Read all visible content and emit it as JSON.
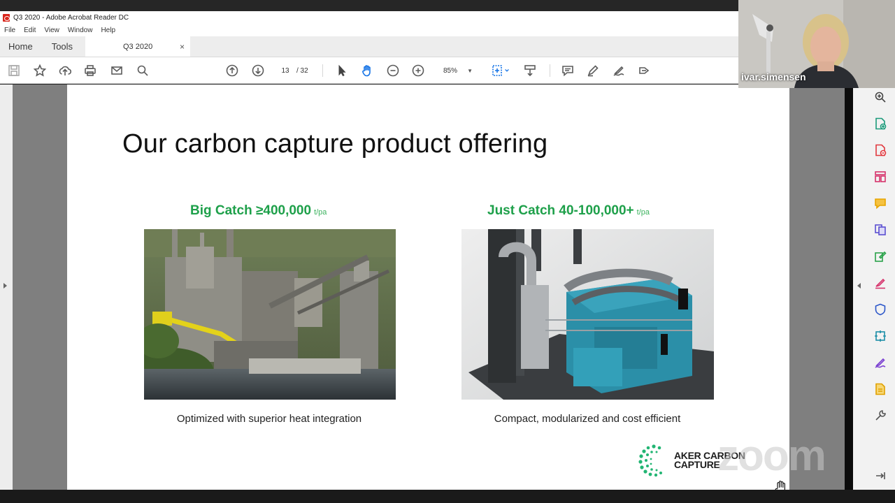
{
  "window": {
    "title": "Q3 2020 - Adobe Acrobat Reader DC"
  },
  "menu": [
    "File",
    "Edit",
    "View",
    "Window",
    "Help"
  ],
  "tabs": {
    "home": "Home",
    "tools": "Tools",
    "document": "Q3 2020",
    "close": "×"
  },
  "toolbar": {
    "current_page": "13",
    "total_pages": "/ 32",
    "zoom": "85%"
  },
  "slide": {
    "title": "Our carbon capture product offering",
    "left": {
      "heading": "Big Catch ≥400,000",
      "unit": "t/pa",
      "caption": "Optimized with superior heat integration"
    },
    "right": {
      "heading": "Just Catch 40-100,000+",
      "unit": "t/pa",
      "caption": "Compact, modularized and cost efficient"
    },
    "logo": {
      "line1": "AKER CARBON",
      "line2": "CAPTURE"
    }
  },
  "video": {
    "participant": "ivar.simensen"
  },
  "watermark": "zoom",
  "colors": {
    "accent_green": "#1ea04a",
    "acrobat_red": "#d9261c"
  },
  "icons": {
    "toolbar": [
      "save-icon",
      "bookmark-star-icon",
      "upload-cloud-icon",
      "print-icon",
      "email-icon",
      "search-icon",
      "previous-page-icon",
      "next-page-icon",
      "select-pointer-icon",
      "hand-tool-icon",
      "zoom-out-icon",
      "zoom-in-icon",
      "fit-page-icon",
      "scroll-mode-icon",
      "comment-icon",
      "highlight-pen-icon",
      "sign-icon",
      "share-icon"
    ],
    "right_panel": [
      "search-zoom-icon",
      "create-pdf-icon",
      "export-pdf-icon",
      "organize-pages-icon",
      "comment-icon",
      "combine-files-icon",
      "edit-pdf-icon",
      "fill-sign-icon",
      "protect-icon",
      "compress-icon",
      "request-signature-icon",
      "more-tools-icon",
      "tools-icon",
      "expand-panel-icon"
    ]
  }
}
